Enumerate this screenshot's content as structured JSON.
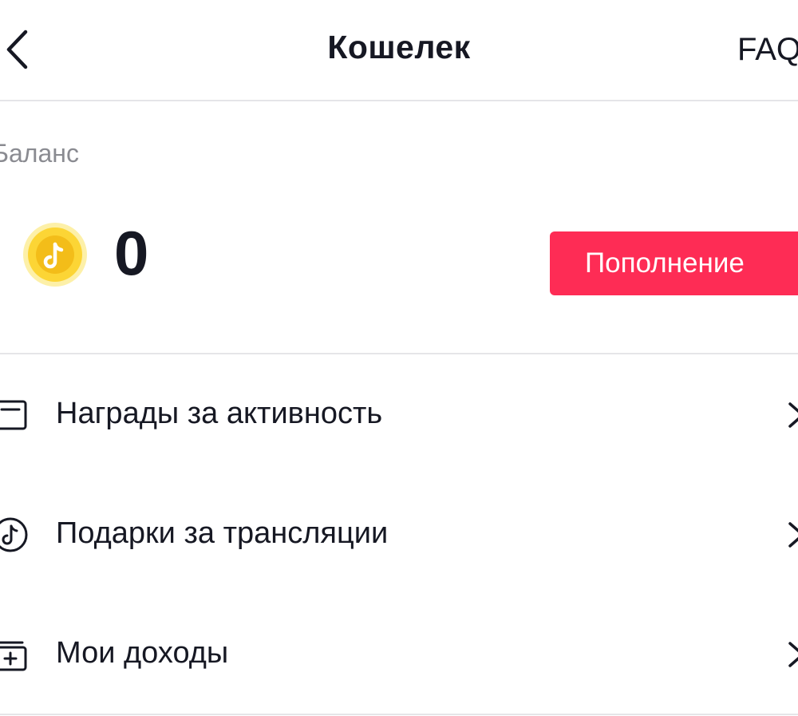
{
  "header": {
    "title": "Кошелек",
    "faq_label": "FAQ"
  },
  "balance": {
    "label": "Баланс",
    "amount": "0",
    "topup_label": "Пополнение"
  },
  "menu": {
    "items": [
      {
        "label": "Награды за активность",
        "icon": "envelope-icon"
      },
      {
        "label": "Подарки за трансляции",
        "icon": "live-gift-icon"
      },
      {
        "label": "Мои доходы",
        "icon": "wallet-plus-icon"
      }
    ]
  },
  "colors": {
    "accent": "#fe2c55",
    "coin": "#fdd835",
    "text": "#161823",
    "secondary_text": "#8a8b91",
    "divider": "#e5e5e8"
  }
}
